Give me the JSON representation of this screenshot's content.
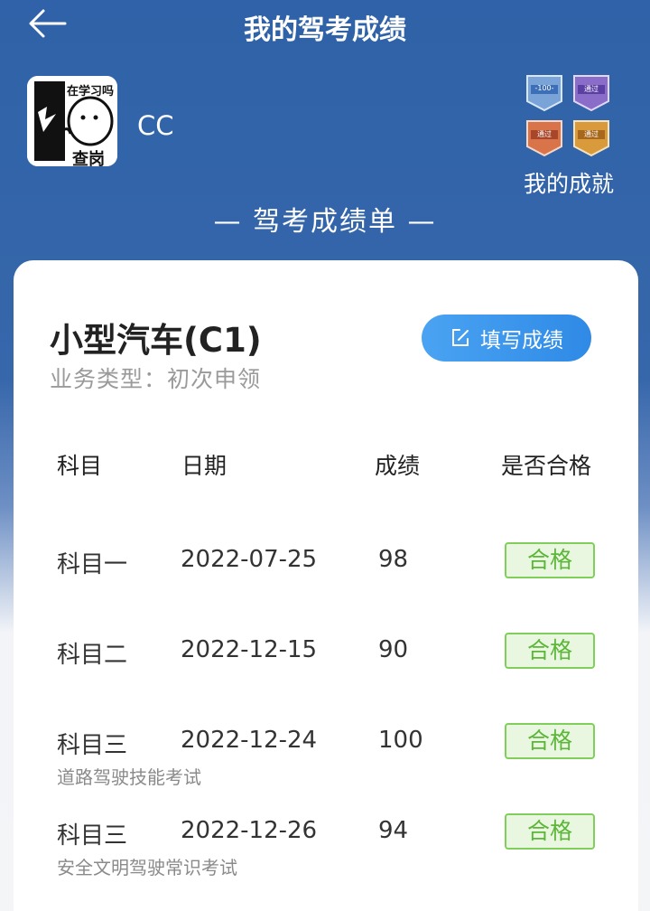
{
  "header": {
    "title": "我的驾考成绩"
  },
  "profile": {
    "username": "CC",
    "avatar_text_top": "在学习吗",
    "avatar_text_bottom": "查岗"
  },
  "achievements": {
    "label": "我的成就",
    "badges": [
      "-100-",
      "通过",
      "通过",
      "通过"
    ]
  },
  "report": {
    "title": "— 驾考成绩单 —"
  },
  "card": {
    "vehicle_title": "小型汽车(C1)",
    "biz_type": "业务类型：初次申领",
    "fill_button": "填写成绩",
    "columns": [
      "科目",
      "日期",
      "成绩",
      "是否合格"
    ],
    "rows": [
      {
        "subject": "科目一",
        "date": "2022-07-25",
        "score": "98",
        "result": "合格",
        "note": ""
      },
      {
        "subject": "科目二",
        "date": "2022-12-15",
        "score": "90",
        "result": "合格",
        "note": ""
      },
      {
        "subject": "科目三",
        "date": "2022-12-24",
        "score": "100",
        "result": "合格",
        "note": "道路驾驶技能考试"
      },
      {
        "subject": "科目三",
        "date": "2022-12-26",
        "score": "94",
        "result": "合格",
        "note": "安全文明驾驶常识考试"
      }
    ]
  },
  "colors": {
    "header_blue": "#2f62a8",
    "button_blue": "#3a94ec",
    "pass_green": "#5cb63a"
  }
}
